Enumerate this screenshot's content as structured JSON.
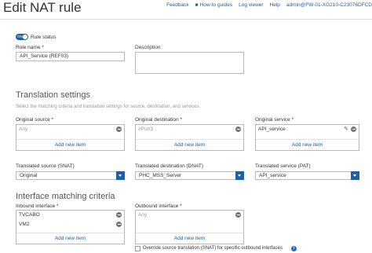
{
  "header": {
    "title": "Edit NAT rule",
    "nav": {
      "feedback": "Feedback",
      "how_to_guides": "How-to guides",
      "log_viewer": "Log viewer",
      "help": "Help",
      "admin": "admin@FW-01-XG210-C23076DFCD"
    }
  },
  "rule_status": {
    "toggle_text": "ON",
    "label": "Rule status"
  },
  "rule_name": {
    "label": "Rule name *",
    "value": "API_Service (REF03)"
  },
  "description": {
    "label": "Description",
    "value": ""
  },
  "translation_settings": {
    "heading": "Translation settings",
    "description": "Select the matching criteria and translation settings for source, destination, and services.",
    "original_source": {
      "label": "Original source *",
      "items": [
        "Any"
      ],
      "add_new": "Add new item"
    },
    "original_destination": {
      "label": "Original destination *",
      "items": [
        "#Port3"
      ],
      "add_new": "Add new item"
    },
    "original_service": {
      "label": "Original service *",
      "items": [
        "API_service"
      ],
      "add_new": "Add new item"
    },
    "translated_source": {
      "label": "Translated source (SNAT)",
      "value": "Original"
    },
    "translated_destination": {
      "label": "Translated destination (DNAT)",
      "value": "PHC_MSS_Server"
    },
    "translated_service": {
      "label": "Translated service (PAT)",
      "value": "API_service"
    }
  },
  "interface_matching": {
    "heading": "Interface matching criteria",
    "inbound": {
      "label": "Inbound interface *",
      "items": [
        "TVCABO",
        "VM2"
      ],
      "add_new": "Add new item"
    },
    "outbound": {
      "label": "Outbound interface *",
      "items": [
        "Any"
      ],
      "add_new": "Add new item"
    },
    "override_label": "Override source translation (SNAT) for specific outbound interfaces"
  },
  "colors": {
    "accent": "#1f5fa3",
    "link": "#1a5f9e",
    "info": "#1f6fd0"
  }
}
